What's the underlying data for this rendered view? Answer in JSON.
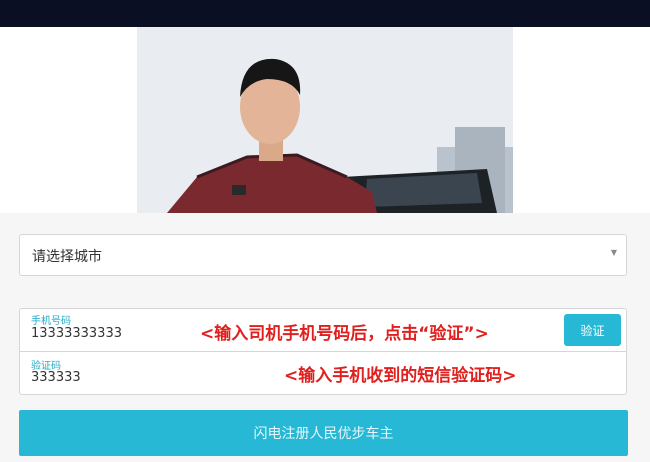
{
  "colors": {
    "accent": "#27b8d6",
    "annotation": "#e0201e",
    "topbar": "#0b0f24"
  },
  "hero": {
    "image_icon": "driver-photo"
  },
  "city_select": {
    "value": "请选择城市",
    "caret_icon": "caret-down"
  },
  "phone_field": {
    "label": "手机号码",
    "value": "13333333333",
    "annotation": "<输入司机手机号码后，点击“验证”>"
  },
  "verify_button": {
    "label": "验证"
  },
  "code_field": {
    "label": "验证码",
    "value": "333333",
    "annotation": "<输入手机收到的短信验证码>"
  },
  "submit_button": {
    "label": "闪电注册人民优步车主"
  }
}
